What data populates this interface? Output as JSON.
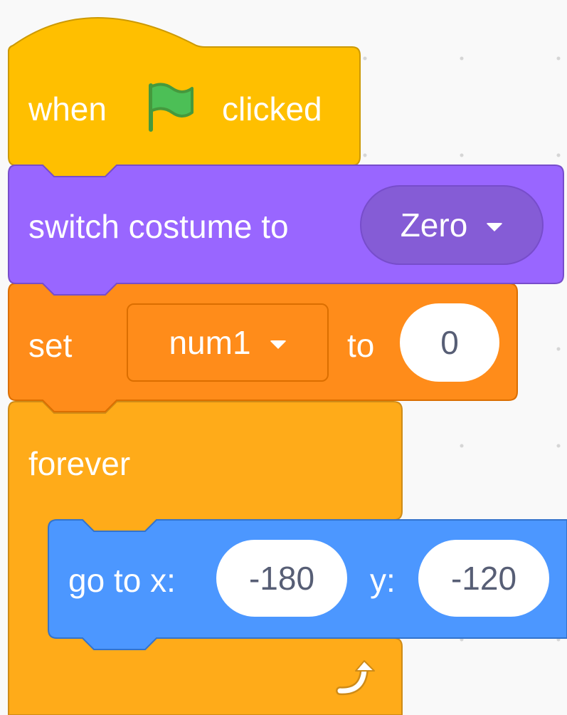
{
  "hat_block": {
    "when": "when",
    "clicked": "clicked",
    "icon": "green-flag-icon"
  },
  "costume_block": {
    "label": "switch costume to",
    "value": "Zero"
  },
  "set_block": {
    "label": "set",
    "variable": "num1",
    "to": "to",
    "value": "0"
  },
  "forever_block": {
    "label": "forever",
    "icon": "loop-arrow-icon"
  },
  "goto_block": {
    "label": "go to x:",
    "x": "-180",
    "y_label": "y:",
    "y": "-120"
  },
  "colors": {
    "events": "#ffbf00",
    "looks": "#9966ff",
    "variables": "#ff8c1a",
    "control": "#ffab19",
    "motion": "#4c97ff"
  }
}
